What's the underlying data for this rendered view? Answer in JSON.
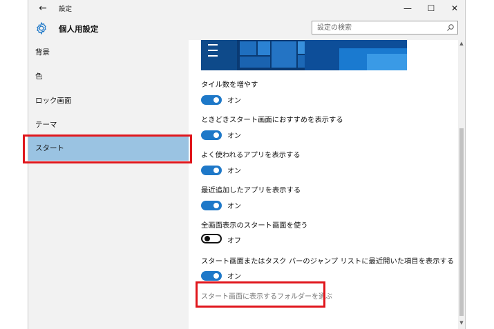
{
  "window": {
    "title": "設定",
    "back_icon": "back-arrow-icon",
    "minimize_icon": "minimize-icon",
    "maximize_icon": "maximize-icon",
    "close_icon": "close-icon"
  },
  "header": {
    "title": "個人用設定",
    "icon": "gear-icon",
    "search_placeholder": "設定の検索"
  },
  "sidebar": {
    "items": [
      {
        "label": "背景",
        "selected": false
      },
      {
        "label": "色",
        "selected": false
      },
      {
        "label": "ロック画面",
        "selected": false
      },
      {
        "label": "テーマ",
        "selected": false
      },
      {
        "label": "スタート",
        "selected": true
      }
    ]
  },
  "content": {
    "settings": [
      {
        "label": "タイル数を増やす",
        "state": "オン",
        "on": true
      },
      {
        "label": "ときどきスタート画面におすすめを表示する",
        "state": "オン",
        "on": true
      },
      {
        "label": "よく使われるアプリを表示する",
        "state": "オン",
        "on": true
      },
      {
        "label": "最近追加したアプリを表示する",
        "state": "オン",
        "on": true
      },
      {
        "label": "全画面表示のスタート画面を使う",
        "state": "オフ",
        "on": false
      },
      {
        "label": "スタート画面またはタスク バーのジャンプ リストに最近開いた項目を表示する",
        "state": "オン",
        "on": true
      }
    ],
    "folder_link": "スタート画面に表示するフォルダーを選ぶ"
  },
  "colors": {
    "accent": "#1e78c8",
    "selected_bg": "#9ac3e2",
    "highlight": "#e0161c",
    "sidebar_bg": "#f2f2f2"
  }
}
